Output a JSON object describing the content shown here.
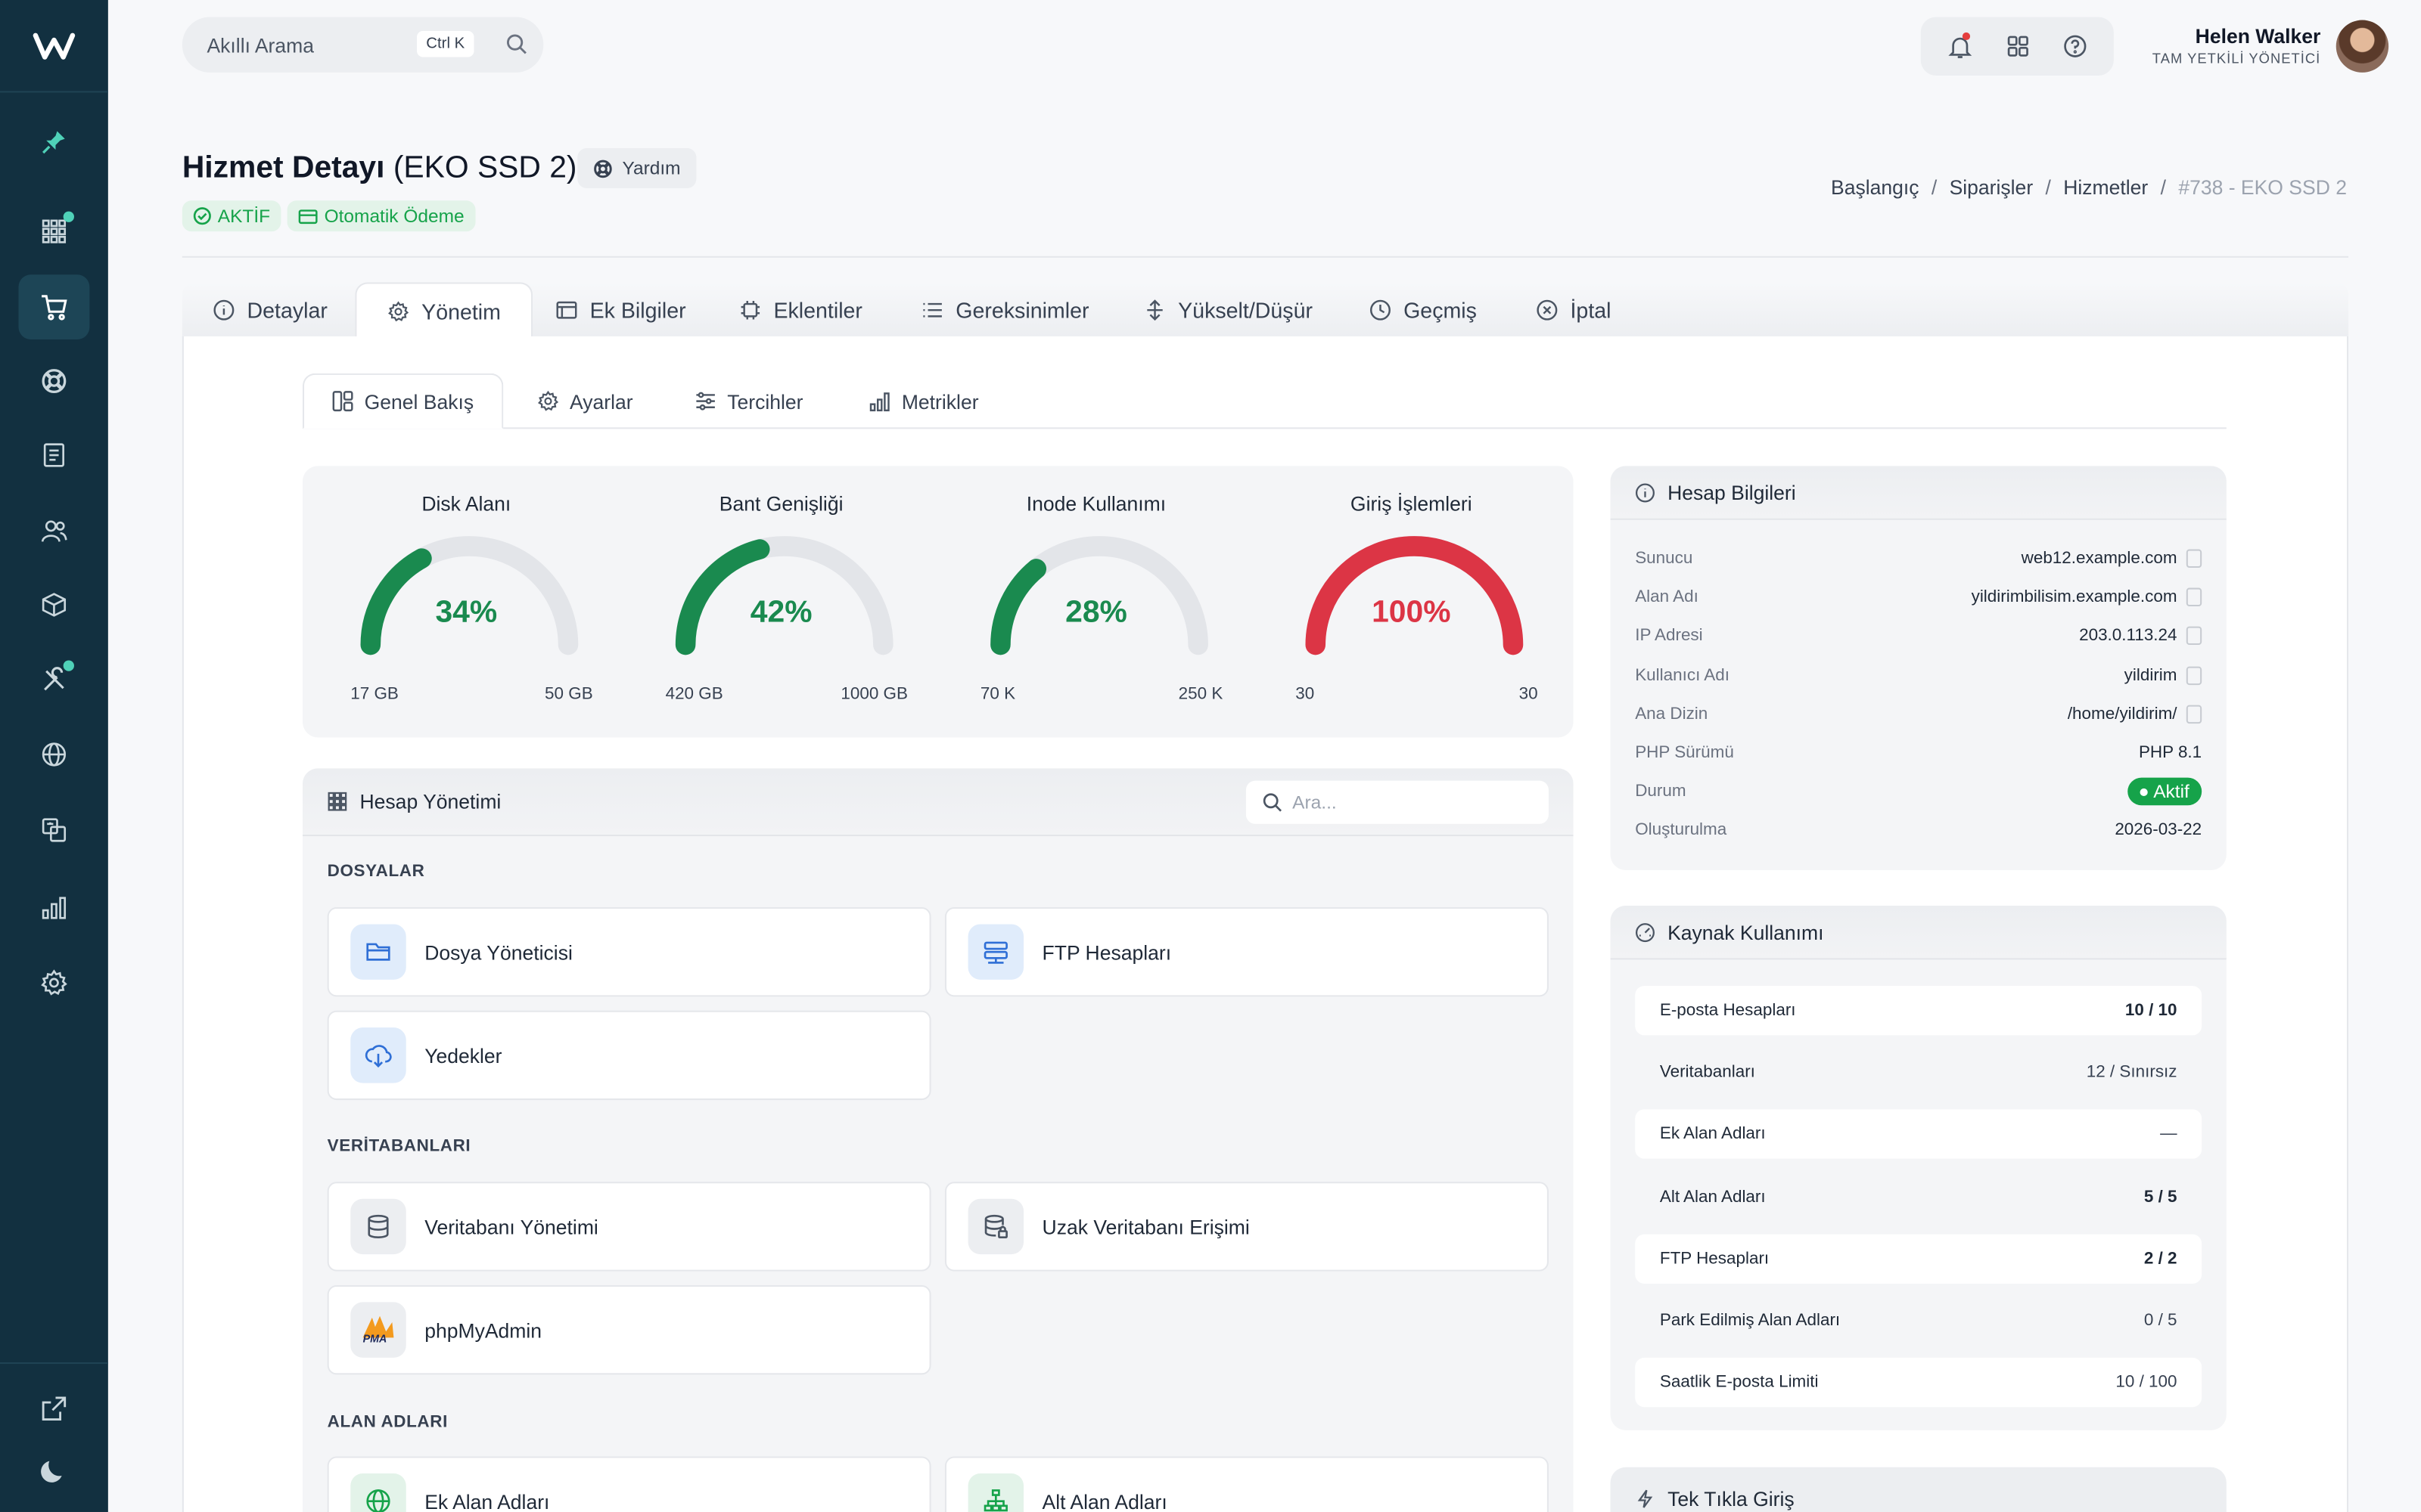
{
  "search": {
    "placeholder": "Akıllı Arama",
    "shortcut": "Ctrl K"
  },
  "user": {
    "name": "Helen Walker",
    "role": "TAM YETKİLİ YÖNETİCİ"
  },
  "page": {
    "title": "Hizmet Detayı",
    "subtitle": "(EKO SSD 2)",
    "help": "Yardım",
    "status": "AKTİF",
    "autopay": "Otomatik Ödeme"
  },
  "breadcrumb": [
    "Başlangıç",
    "Siparişler",
    "Hizmetler",
    "#738 - EKO SSD 2"
  ],
  "tabs": [
    "Detaylar",
    "Yönetim",
    "Ek Bilgiler",
    "Eklentiler",
    "Gereksinimler",
    "Yükselt/Düşür",
    "Geçmiş",
    "İptal"
  ],
  "subtabs": [
    "Genel Bakış",
    "Ayarlar",
    "Tercihler",
    "Metrikler"
  ],
  "gauges": [
    {
      "title": "Disk Alanı",
      "pct": "34%",
      "value": 0.34,
      "min": "17 GB",
      "max": "50 GB",
      "color": "#1a8a4f"
    },
    {
      "title": "Bant Genişliği",
      "pct": "42%",
      "value": 0.42,
      "min": "420 GB",
      "max": "1000 GB",
      "color": "#1a8a4f"
    },
    {
      "title": "Inode Kullanımı",
      "pct": "28%",
      "value": 0.28,
      "min": "70 K",
      "max": "250 K",
      "color": "#1a8a4f"
    },
    {
      "title": "Giriş İşlemleri",
      "pct": "100%",
      "value": 1.0,
      "min": "30",
      "max": "30",
      "color": "#dc3545"
    }
  ],
  "mgmt": {
    "title": "Hesap Yönetimi",
    "search": "Ara...",
    "sections": [
      "DOSYALAR",
      "VERİTABANLARI",
      "ALAN ADLARI"
    ],
    "cards": [
      "Dosya Yöneticisi",
      "FTP Hesapları",
      "Yedekler",
      "Veritabanı Yönetimi",
      "Uzak Veritabanı Erişimi",
      "phpMyAdmin",
      "Ek Alan Adları",
      "Alt Alan Adları"
    ],
    "pma": "PMA"
  },
  "info": {
    "title": "Hesap Bilgileri",
    "rows": [
      {
        "k": "Sunucu",
        "v": "web12.example.com"
      },
      {
        "k": "Alan Adı",
        "v": "yildirimbilisim.example.com"
      },
      {
        "k": "IP Adresi",
        "v": "203.0.113.24"
      },
      {
        "k": "Kullanıcı Adı",
        "v": "yildirim"
      },
      {
        "k": "Ana Dizin",
        "v": "/home/yildirim/"
      },
      {
        "k": "PHP Sürümü",
        "v": "PHP 8.1"
      },
      {
        "k": "Durum",
        "v": "Aktif"
      },
      {
        "k": "Oluşturulma",
        "v": "2026-03-22"
      }
    ]
  },
  "resources": {
    "title": "Kaynak Kullanımı",
    "rows": [
      {
        "k": "E-posta Hesapları",
        "v": "10 / 10"
      },
      {
        "k": "Veritabanları",
        "v": "12 / Sınırsız"
      },
      {
        "k": "Ek Alan Adları",
        "v": "—"
      },
      {
        "k": "Alt Alan Adları",
        "v": "5 / 5"
      },
      {
        "k": "FTP Hesapları",
        "v": "2 / 2"
      },
      {
        "k": "Park Edilmiş Alan Adları",
        "v": "0 / 5"
      },
      {
        "k": "Saatlik E-posta Limiti",
        "v": "10 / 100"
      }
    ]
  },
  "oneclick": "Tek Tıkla Giriş"
}
